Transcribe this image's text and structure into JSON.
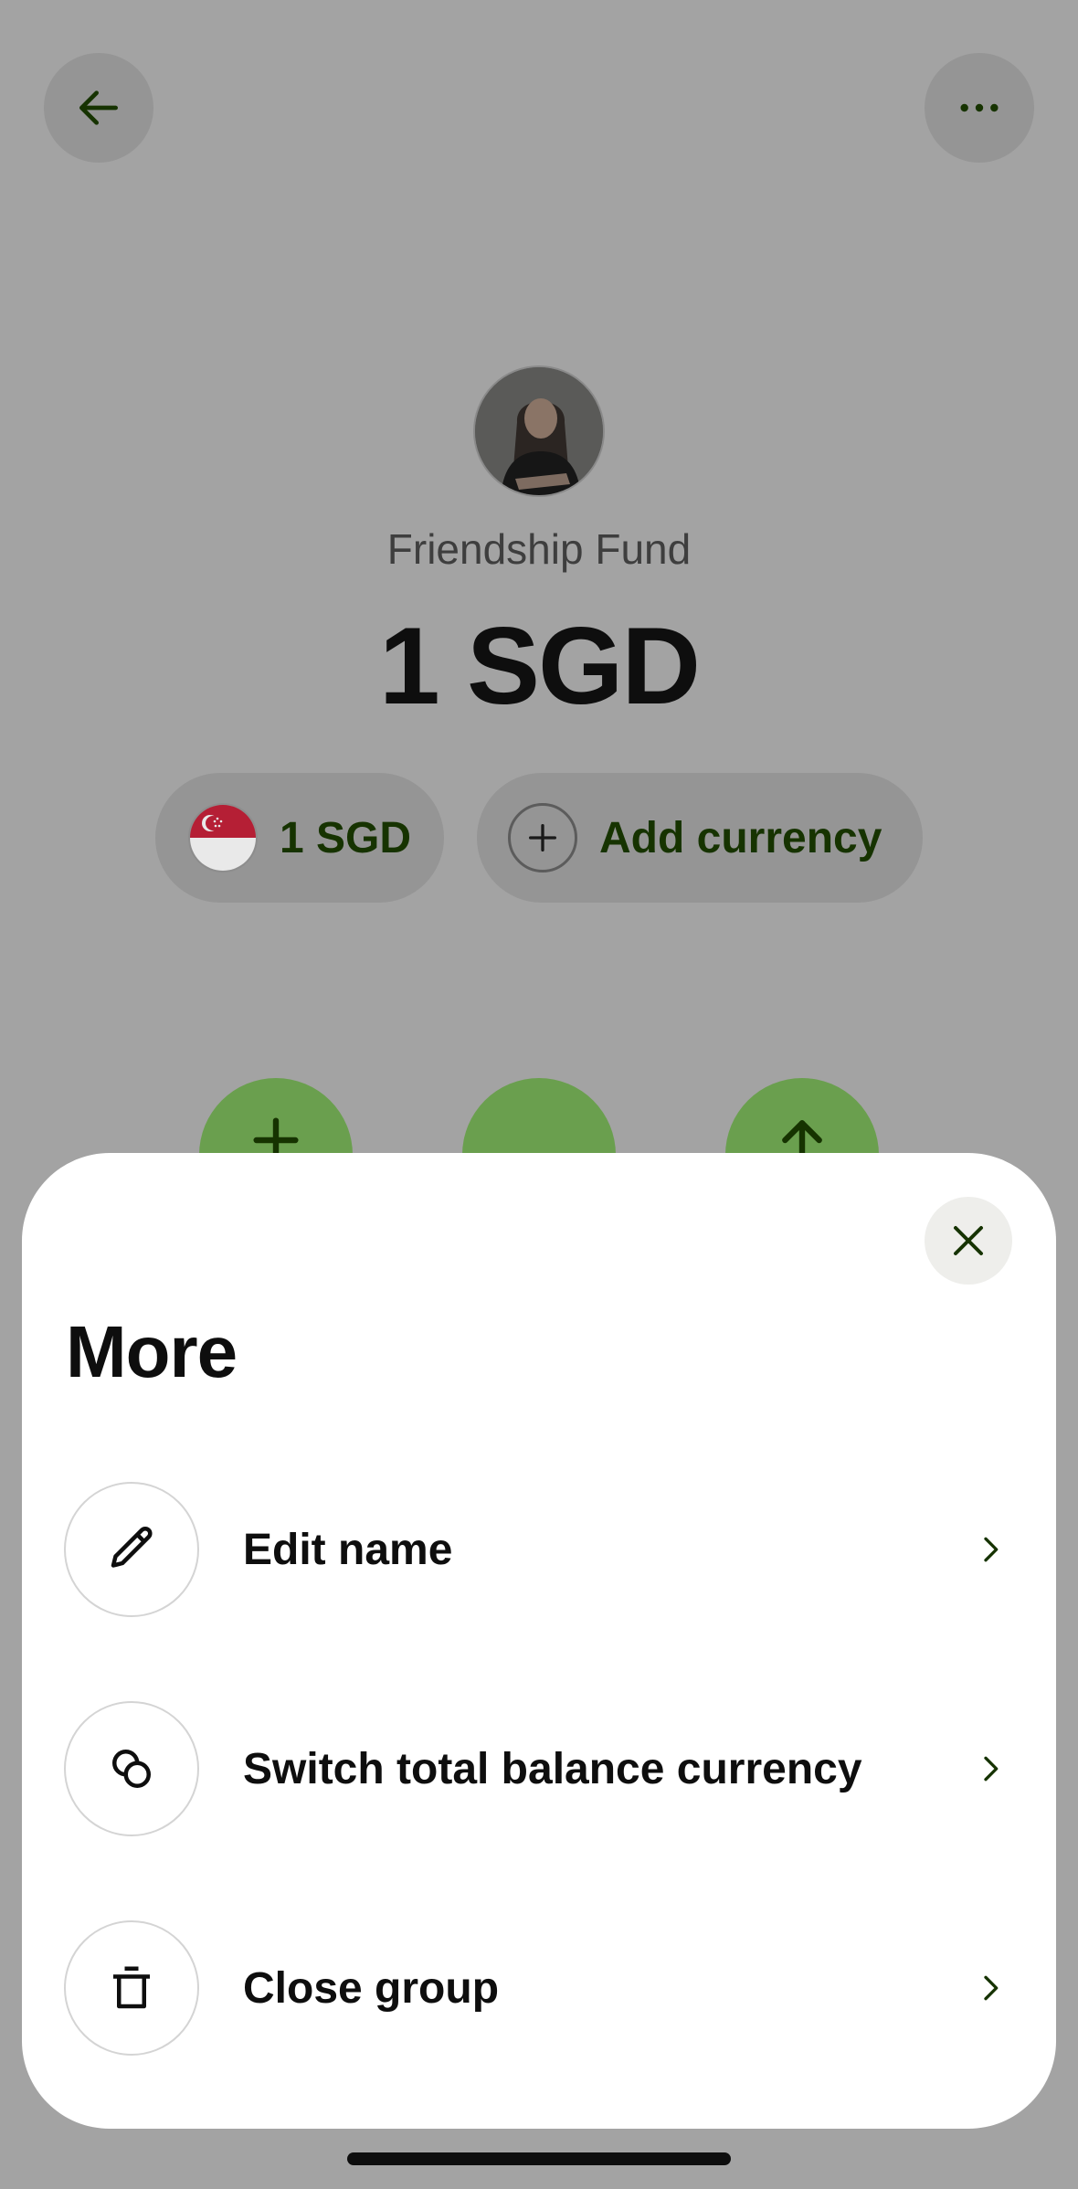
{
  "header": {
    "back_icon": "arrow-left-icon",
    "more_icon": "more-horizontal-icon"
  },
  "group": {
    "name": "Friendship Fund",
    "total_balance": "1 SGD"
  },
  "balances": {
    "sgd_chip_label": "1 SGD",
    "sgd_flag_icon": "singapore-flag-icon",
    "add_currency_label": "Add currency",
    "add_currency_icon": "plus-icon"
  },
  "sheet": {
    "title": "More",
    "close_icon": "close-icon",
    "items": [
      {
        "label": "Edit name",
        "icon": "pencil-icon"
      },
      {
        "label": "Switch total balance currency",
        "icon": "currency-switch-icon"
      },
      {
        "label": "Close group",
        "icon": "trash-icon"
      }
    ]
  },
  "colors": {
    "accent_green": "#9fe870",
    "dim_overlay": "#a3a3a3",
    "text_dark_green": "#163300"
  }
}
